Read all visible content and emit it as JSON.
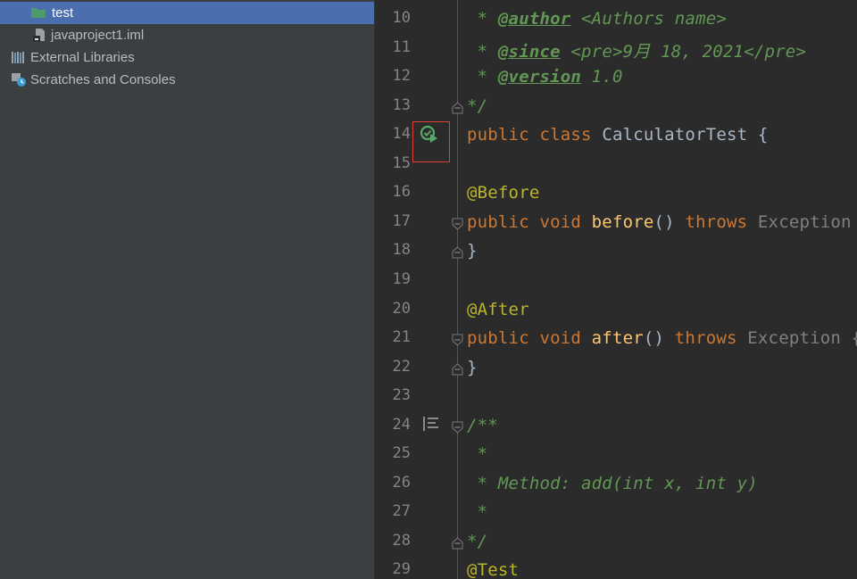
{
  "project_tree": {
    "items": [
      {
        "label": "test",
        "icon": "folder-icon",
        "selected": true
      },
      {
        "label": "javaproject1.iml",
        "icon": "module-file-icon",
        "selected": false
      },
      {
        "label": "External Libraries",
        "icon": "library-icon",
        "selected": false
      },
      {
        "label": "Scratches and Consoles",
        "icon": "scratches-icon",
        "selected": false
      }
    ]
  },
  "editor": {
    "lines": [
      {
        "num": "10",
        "tokens": [
          {
            "t": "comment",
            "v": " * "
          },
          {
            "t": "tag",
            "v": "@author"
          },
          {
            "t": "comment",
            "v": " <Authors name>"
          }
        ]
      },
      {
        "num": "11",
        "tokens": [
          {
            "t": "comment",
            "v": " * "
          },
          {
            "t": "tag",
            "v": "@since"
          },
          {
            "t": "comment",
            "v": " <pre>9月 18, 2021</pre>"
          }
        ]
      },
      {
        "num": "12",
        "tokens": [
          {
            "t": "comment",
            "v": " * "
          },
          {
            "t": "tag",
            "v": "@version"
          },
          {
            "t": "comment",
            "v": " 1.0"
          }
        ]
      },
      {
        "num": "13",
        "fold": "end",
        "tokens": [
          {
            "t": "comment",
            "v": "*/"
          }
        ]
      },
      {
        "num": "14",
        "tokens": [
          {
            "t": "kw",
            "v": "public class "
          },
          {
            "t": "plain",
            "v": "CalculatorTest {"
          }
        ]
      },
      {
        "num": "15",
        "tokens": []
      },
      {
        "num": "16",
        "tokens": [
          {
            "t": "ann",
            "v": "@Before"
          }
        ]
      },
      {
        "num": "17",
        "fold": "start",
        "tokens": [
          {
            "t": "kw",
            "v": "public void "
          },
          {
            "t": "fn",
            "v": "before"
          },
          {
            "t": "plain",
            "v": "() "
          },
          {
            "t": "kw",
            "v": "throws "
          },
          {
            "t": "type",
            "v": "Exception {"
          }
        ]
      },
      {
        "num": "18",
        "fold": "end",
        "tokens": [
          {
            "t": "plain",
            "v": "}"
          }
        ]
      },
      {
        "num": "19",
        "tokens": []
      },
      {
        "num": "20",
        "tokens": [
          {
            "t": "ann",
            "v": "@After"
          }
        ]
      },
      {
        "num": "21",
        "fold": "start",
        "tokens": [
          {
            "t": "kw",
            "v": "public void "
          },
          {
            "t": "fn",
            "v": "after"
          },
          {
            "t": "plain",
            "v": "() "
          },
          {
            "t": "kw",
            "v": "throws "
          },
          {
            "t": "type",
            "v": "Exception {"
          }
        ]
      },
      {
        "num": "22",
        "fold": "end",
        "tokens": [
          {
            "t": "plain",
            "v": "}"
          }
        ]
      },
      {
        "num": "23",
        "tokens": []
      },
      {
        "num": "24",
        "fold": "start",
        "tokens": [
          {
            "t": "comment",
            "v": "/**"
          }
        ]
      },
      {
        "num": "25",
        "tokens": [
          {
            "t": "comment",
            "v": " *"
          }
        ]
      },
      {
        "num": "26",
        "tokens": [
          {
            "t": "comment",
            "v": " * Method: add(int x, int y)"
          }
        ]
      },
      {
        "num": "27",
        "tokens": [
          {
            "t": "comment",
            "v": " *"
          }
        ]
      },
      {
        "num": "28",
        "fold": "end",
        "tokens": [
          {
            "t": "comment",
            "v": "*/"
          }
        ]
      },
      {
        "num": "29",
        "tokens": [
          {
            "t": "ann",
            "v": "@Test"
          }
        ]
      }
    ],
    "gutter": {
      "run_icon": "run-test-icon",
      "run_line": "14",
      "implemented_icon": "method-list-icon",
      "implemented_line": "24"
    }
  },
  "colors": {
    "sidebar_bg": "#3c3f41",
    "selection": "#4b6eaf",
    "editor_bg": "#2b2b2b",
    "comment": "#629755",
    "keyword": "#cc7832",
    "annotation": "#bbb529",
    "function": "#ffc66d",
    "highlight_box": "#e0403a"
  }
}
